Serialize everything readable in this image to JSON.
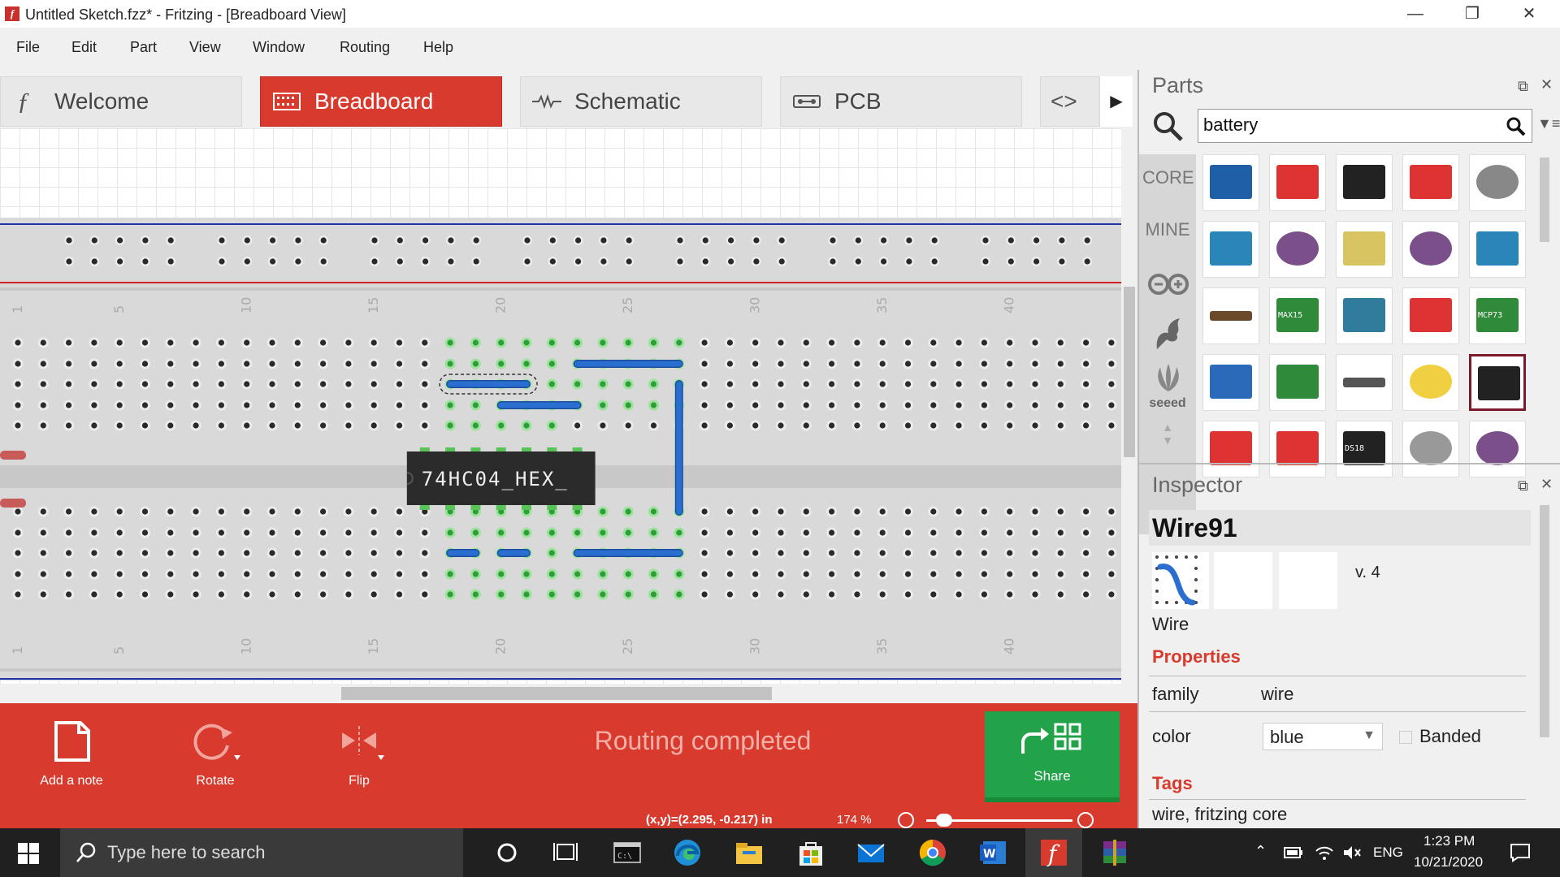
{
  "window": {
    "title": "Untitled Sketch.fzz* - Fritzing - [Breadboard View]",
    "app_icon": "fritzing-f-icon",
    "controls": [
      "minimize-icon",
      "restore-icon",
      "close-icon"
    ]
  },
  "menu": [
    "File",
    "Edit",
    "Part",
    "View",
    "Window",
    "Routing",
    "Help"
  ],
  "tabs": [
    {
      "label": "Welcome",
      "icon": "fritzing-logo-icon",
      "active": false
    },
    {
      "label": "Breadboard",
      "icon": "breadboard-icon",
      "active": true
    },
    {
      "label": "Schematic",
      "icon": "resistor-icon",
      "active": false
    },
    {
      "label": "PCB",
      "icon": "pcb-icon",
      "active": false
    }
  ],
  "breadboard": {
    "column_labels": [
      "1",
      "5",
      "10",
      "15",
      "20",
      "25",
      "30",
      "35",
      "40"
    ],
    "chip_label": "74HC04_HEX_",
    "colors": {
      "board": "#d9d9d9",
      "hole": "#2a2a2a",
      "connected": "#55cc55",
      "wire": "#2a6fd0",
      "rail_blue": "#2233aa",
      "rail_red": "#cc2222"
    }
  },
  "toolbar": {
    "add_note": "Add a note",
    "rotate": "Rotate",
    "flip": "Flip",
    "routing_status": "Routing completed",
    "share": "Share"
  },
  "status": {
    "coords": "(x,y)=(2.295, -0.217) in",
    "zoom": "174 %"
  },
  "parts": {
    "title": "Parts",
    "search_value": "battery",
    "bins": [
      "CORE",
      "MINE"
    ],
    "bin_icons": [
      "arduino-icon",
      "sparkfun-flame-icon",
      "seeed-icon"
    ],
    "bin_seeed_label": "seeed",
    "thumbnails": [
      "sensor-module-blue",
      "red-module",
      "black-battery-pack",
      "red-board",
      "coin-cell",
      "blue-module",
      "lilypad-holder",
      "lipo-battery",
      "lilypad-coin-holder",
      "blue-module-2",
      "aa-battery",
      "max-board",
      "arduino-shield",
      "red-board-2",
      "mcp-board",
      "arduino-blue",
      "green-board",
      "aa-battery-2",
      "yellow-coin-holder",
      "battery-pack-selected",
      "red-small-board",
      "red-board-3",
      "ds18-chip",
      "coin-cell-2",
      "purple-holder"
    ],
    "selected_index": 19,
    "thumb_labels": {
      "max": "MAX15",
      "mcp": "MCP73",
      "ds": "DS18"
    }
  },
  "inspector": {
    "title": "Inspector",
    "part_name": "Wire91",
    "version": "v. 4",
    "type_label": "Wire",
    "properties_heading": "Properties",
    "family_key": "family",
    "family_value": "wire",
    "color_key": "color",
    "color_value": "blue",
    "banded_label": "Banded",
    "tags_heading": "Tags",
    "tags_value": "wire, fritzing core"
  },
  "taskbar": {
    "search_placeholder": "Type here to search",
    "apps": [
      "cortana-icon",
      "task-view-icon",
      "terminal-icon",
      "edge-icon",
      "file-explorer-icon",
      "store-icon",
      "mail-icon",
      "chrome-icon",
      "word-icon",
      "fritzing-icon",
      "winrar-icon"
    ],
    "language": "ENG",
    "time": "1:23 PM",
    "date": "10/21/2020"
  }
}
